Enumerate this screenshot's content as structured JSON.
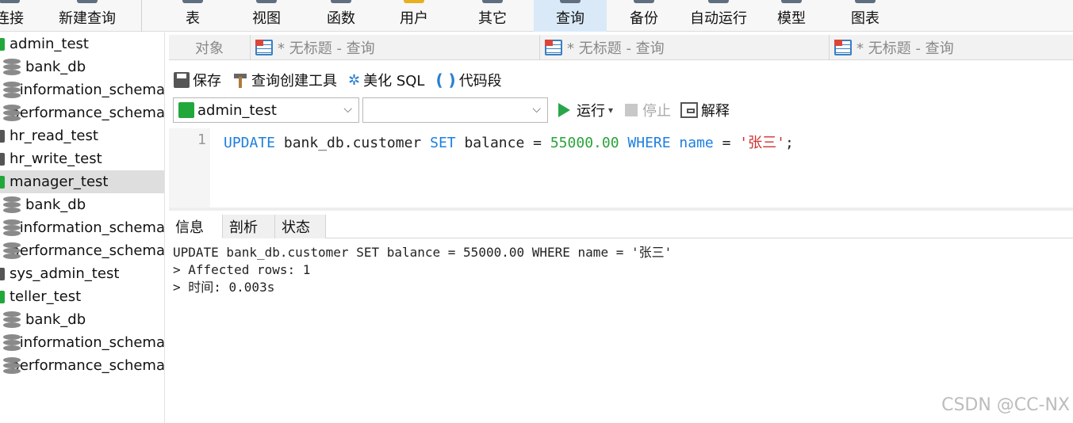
{
  "toolbar": {
    "items": [
      {
        "label": "连接",
        "icon": "connect-icon"
      },
      {
        "label": "新建查询",
        "icon": "new-query-icon"
      },
      {
        "label": "表",
        "icon": "table-icon"
      },
      {
        "label": "视图",
        "icon": "view-icon"
      },
      {
        "label": "函数",
        "icon": "function-icon"
      },
      {
        "label": "用户",
        "icon": "user-icon"
      },
      {
        "label": "其它",
        "icon": "other-icon"
      },
      {
        "label": "查询",
        "icon": "query-icon",
        "active": true
      },
      {
        "label": "备份",
        "icon": "backup-icon"
      },
      {
        "label": "自动运行",
        "icon": "automation-icon"
      },
      {
        "label": "模型",
        "icon": "model-icon"
      },
      {
        "label": "图表",
        "icon": "chart-icon"
      }
    ]
  },
  "sidebar": {
    "items": [
      {
        "label": "admin_test",
        "kind": "user"
      },
      {
        "label": "bank_db",
        "kind": "db"
      },
      {
        "label": "information_schema",
        "kind": "db"
      },
      {
        "label": "performance_schema",
        "kind": "db"
      },
      {
        "label": "hr_read_test",
        "kind": "user-dark"
      },
      {
        "label": "hr_write_test",
        "kind": "user-dark"
      },
      {
        "label": "manager_test",
        "kind": "user",
        "selected": true
      },
      {
        "label": "bank_db",
        "kind": "db"
      },
      {
        "label": "information_schema",
        "kind": "db"
      },
      {
        "label": "performance_schema",
        "kind": "db"
      },
      {
        "label": "sys_admin_test",
        "kind": "user-dark"
      },
      {
        "label": "teller_test",
        "kind": "user"
      },
      {
        "label": "bank_db",
        "kind": "db"
      },
      {
        "label": "information_schema",
        "kind": "db"
      },
      {
        "label": "performance_schema",
        "kind": "db"
      }
    ]
  },
  "tabs": {
    "objects_label": "对象",
    "query_tabs": [
      "* 无标题 - 查询",
      "* 无标题 - 查询",
      "* 无标题 - 查询"
    ]
  },
  "query_toolbar": {
    "save": "保存",
    "builder": "查询创建工具",
    "beautify": "美化 SQL",
    "snippet": "代码段"
  },
  "selectors": {
    "connection": "admin_test",
    "database": "",
    "run": "运行",
    "stop": "停止",
    "explain": "解释"
  },
  "editor": {
    "line_number": "1",
    "tokens": {
      "t1": "UPDATE",
      "t2": " bank_db.customer ",
      "t3": "SET",
      "t4": " balance = ",
      "t5": "55000.00",
      "t6": " ",
      "t7": "WHERE",
      "t8": " ",
      "t9": "name",
      "t10": " = ",
      "t11": "'张三'",
      "t12": ";"
    }
  },
  "result_tabs": [
    "信息",
    "剖析",
    "状态"
  ],
  "output": {
    "line1": "UPDATE bank_db.customer SET balance = 55000.00 WHERE name = '张三'",
    "line2": "> Affected rows: 1",
    "line3": "> 时间: 0.003s"
  },
  "watermark": "CSDN @CC-NX",
  "colors": {
    "keyword": "#1e7fe0",
    "number": "#2aa33a",
    "string": "#d0302f",
    "active_tab": "#d9e9f8"
  }
}
